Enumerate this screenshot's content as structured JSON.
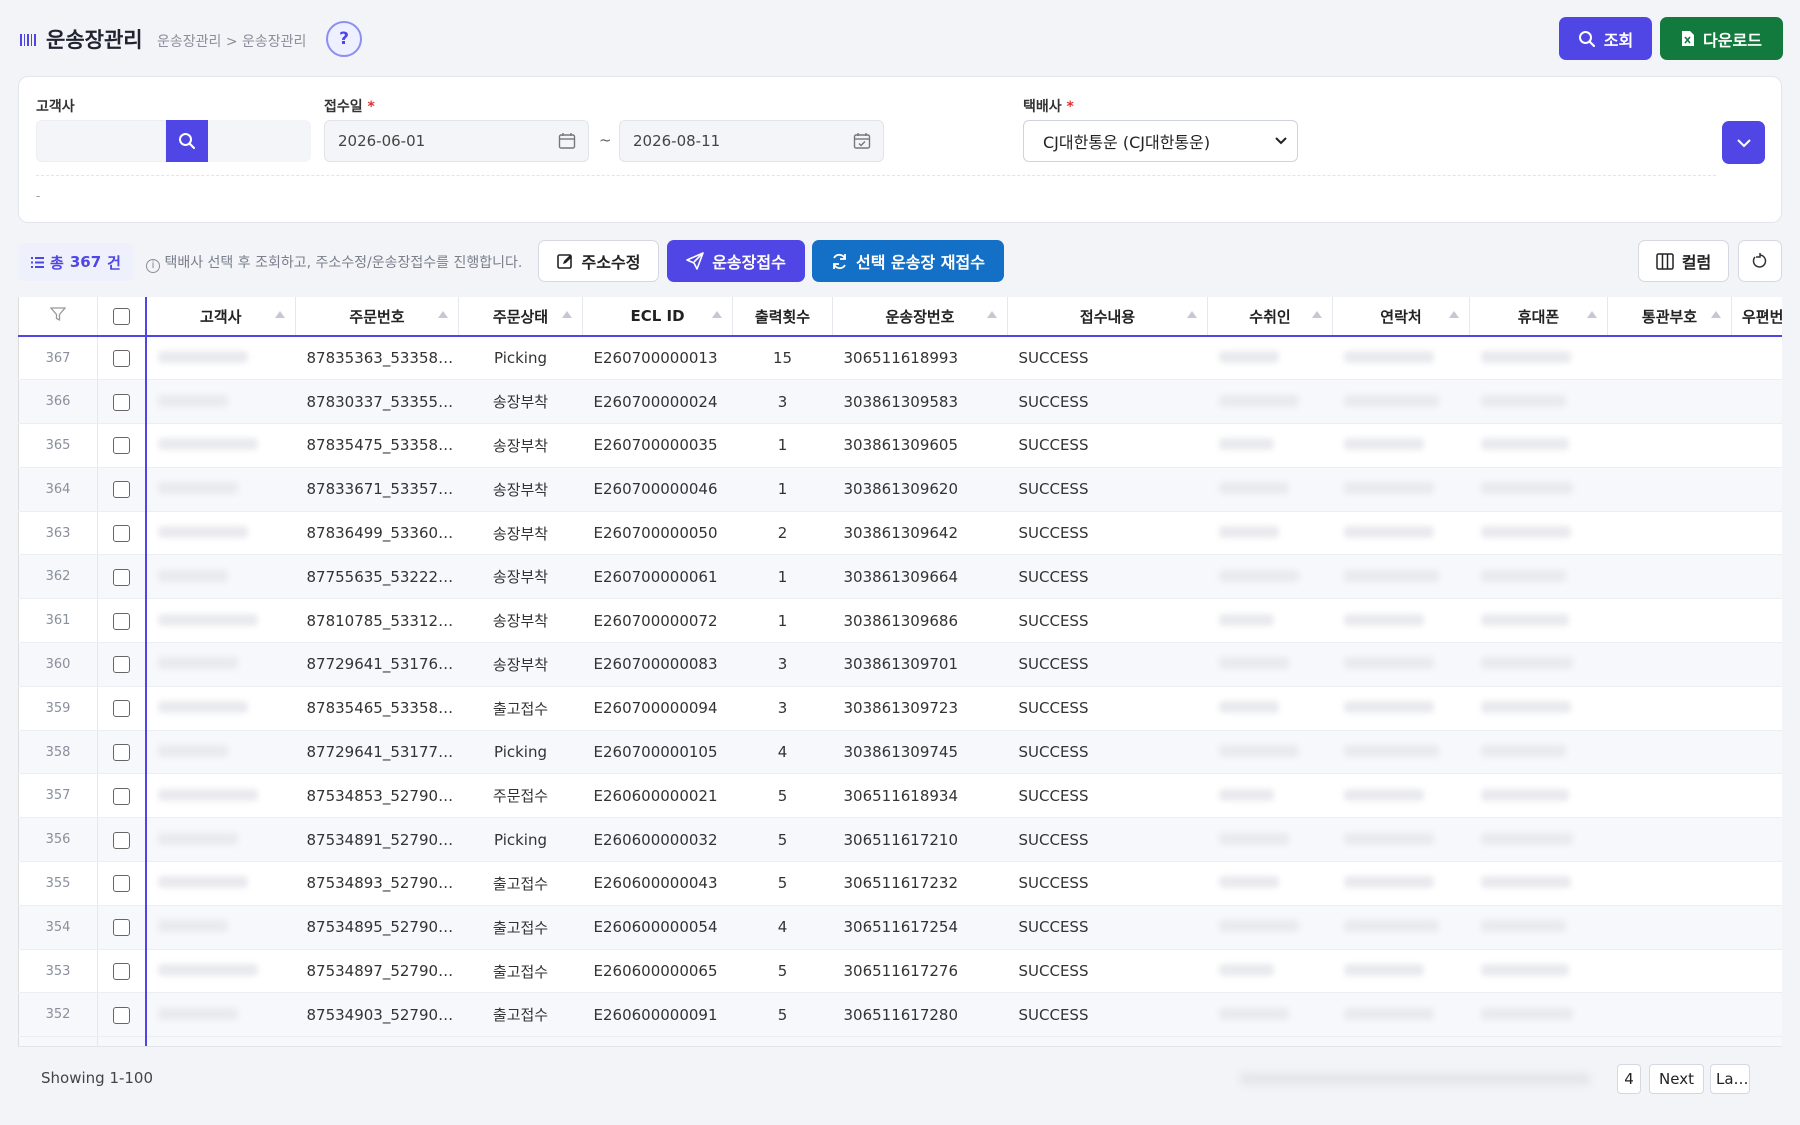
{
  "header": {
    "title": "운송장관리",
    "breadcrumb": "운송장관리 > 운송장관리",
    "help_label": "?",
    "search_label": "조회",
    "download_label": "다운로드"
  },
  "filters": {
    "client_label": "고객사",
    "date_label": "접수일",
    "required_mark": "*",
    "date_from": "2026-06-01",
    "date_to": "2026-08-11",
    "date_sep": "~",
    "courier_label": "택배사",
    "courier_value": "CJ대한통운 (CJ대한통운)",
    "note": "-"
  },
  "toolbar": {
    "total_prefix": "총",
    "total_count": "367",
    "total_suffix": "건",
    "hint": "택배사 선택 후 조회하고, 주소수정/운송장접수를 진행합니다.",
    "address_edit": "주소수정",
    "waybill_receive": "운송장접수",
    "waybill_reissue": "선택 운송장 재접수",
    "columns": "컬럼"
  },
  "table": {
    "columns": [
      "고객사",
      "주문번호",
      "주문상태",
      "ECL ID",
      "출력횟수",
      "운송장번호",
      "접수내용",
      "수취인",
      "연락처",
      "휴대폰",
      "통관부호",
      "우편번"
    ],
    "rows": [
      {
        "no": "367",
        "order": "87835363_53358…",
        "status": "Picking",
        "ecl": "E260700000013",
        "prints": "15",
        "waybill": "306511618993",
        "result": "SUCCESS"
      },
      {
        "no": "366",
        "order": "87830337_53355…",
        "status": "송장부착",
        "ecl": "E260700000024",
        "prints": "3",
        "waybill": "303861309583",
        "result": "SUCCESS"
      },
      {
        "no": "365",
        "order": "87835475_53358…",
        "status": "송장부착",
        "ecl": "E260700000035",
        "prints": "1",
        "waybill": "303861309605",
        "result": "SUCCESS"
      },
      {
        "no": "364",
        "order": "87833671_53357…",
        "status": "송장부착",
        "ecl": "E260700000046",
        "prints": "1",
        "waybill": "303861309620",
        "result": "SUCCESS"
      },
      {
        "no": "363",
        "order": "87836499_53360…",
        "status": "송장부착",
        "ecl": "E260700000050",
        "prints": "2",
        "waybill": "303861309642",
        "result": "SUCCESS"
      },
      {
        "no": "362",
        "order": "87755635_53222…",
        "status": "송장부착",
        "ecl": "E260700000061",
        "prints": "1",
        "waybill": "303861309664",
        "result": "SUCCESS"
      },
      {
        "no": "361",
        "order": "87810785_53312…",
        "status": "송장부착",
        "ecl": "E260700000072",
        "prints": "1",
        "waybill": "303861309686",
        "result": "SUCCESS"
      },
      {
        "no": "360",
        "order": "87729641_53176…",
        "status": "송장부착",
        "ecl": "E260700000083",
        "prints": "3",
        "waybill": "303861309701",
        "result": "SUCCESS"
      },
      {
        "no": "359",
        "order": "87835465_53358…",
        "status": "출고접수",
        "ecl": "E260700000094",
        "prints": "3",
        "waybill": "303861309723",
        "result": "SUCCESS"
      },
      {
        "no": "358",
        "order": "87729641_53177…",
        "status": "Picking",
        "ecl": "E260700000105",
        "prints": "4",
        "waybill": "303861309745",
        "result": "SUCCESS"
      },
      {
        "no": "357",
        "order": "87534853_52790…",
        "status": "주문접수",
        "ecl": "E260600000021",
        "prints": "5",
        "waybill": "306511618934",
        "result": "SUCCESS"
      },
      {
        "no": "356",
        "order": "87534891_52790…",
        "status": "Picking",
        "ecl": "E260600000032",
        "prints": "5",
        "waybill": "306511617210",
        "result": "SUCCESS"
      },
      {
        "no": "355",
        "order": "87534893_52790…",
        "status": "출고접수",
        "ecl": "E260600000043",
        "prints": "5",
        "waybill": "306511617232",
        "result": "SUCCESS"
      },
      {
        "no": "354",
        "order": "87534895_52790…",
        "status": "출고접수",
        "ecl": "E260600000054",
        "prints": "4",
        "waybill": "306511617254",
        "result": "SUCCESS"
      },
      {
        "no": "353",
        "order": "87534897_52790…",
        "status": "출고접수",
        "ecl": "E260600000065",
        "prints": "5",
        "waybill": "306511617276",
        "result": "SUCCESS"
      },
      {
        "no": "352",
        "order": "87534903_52790…",
        "status": "출고접수",
        "ecl": "E260600000091",
        "prints": "5",
        "waybill": "306511617280",
        "result": "SUCCESS"
      }
    ]
  },
  "pagination": {
    "showing": "Showing 1-100",
    "page": "4",
    "next": "Next",
    "last": "La…"
  },
  "colors": {
    "accent": "#4f46e5",
    "download": "#137a3e",
    "reissue": "#1470c6"
  }
}
